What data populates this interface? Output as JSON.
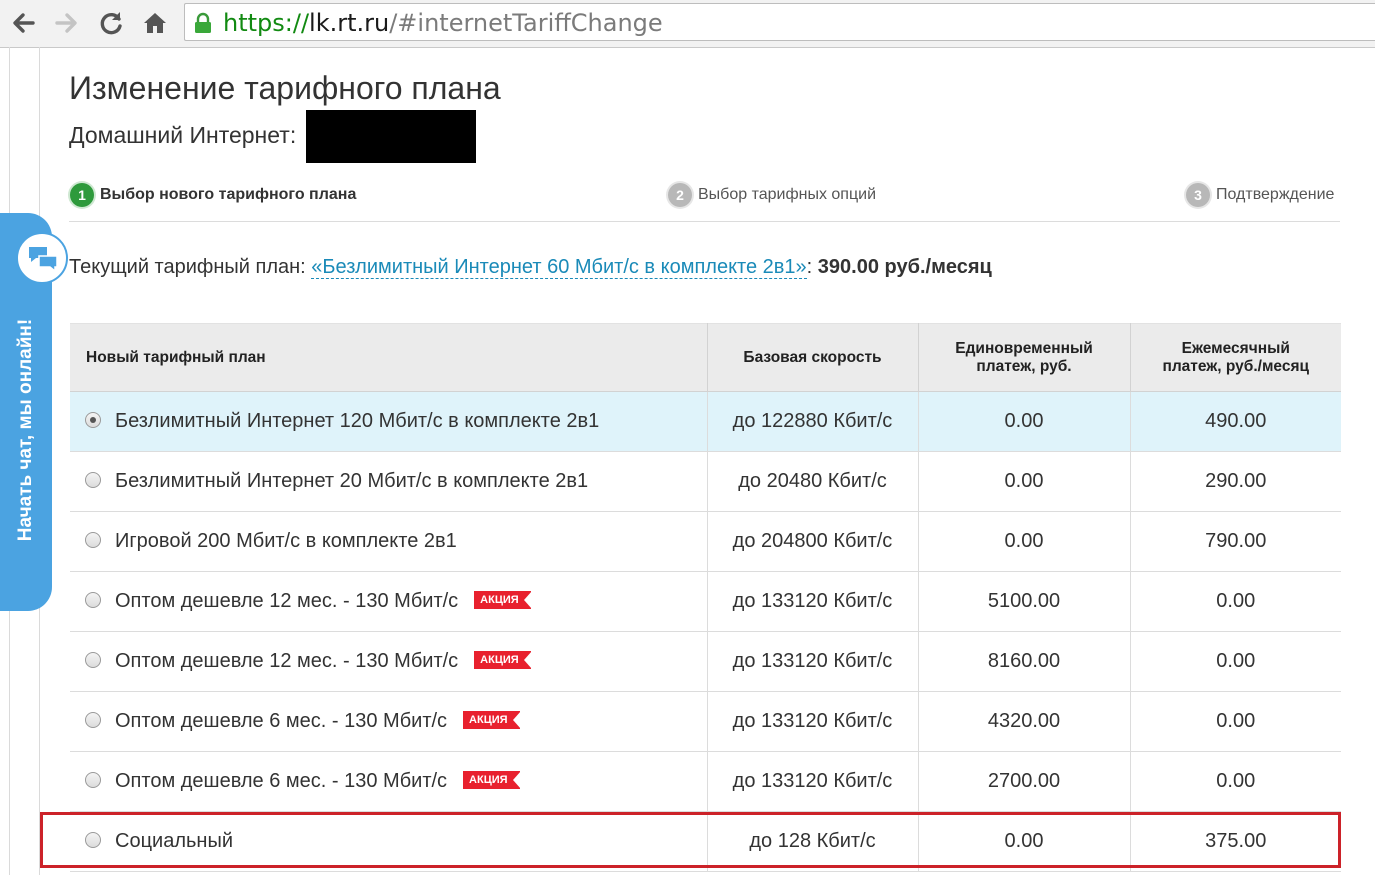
{
  "browser": {
    "url_scheme": "https://",
    "url_host": "lk.rt.ru",
    "url_path": "/#internetTariffChange"
  },
  "chat": {
    "label": "Начать чат, мы онлайн!"
  },
  "page": {
    "title": "Изменение тарифного плана",
    "service_label": "Домашний Интернет:"
  },
  "steps": [
    {
      "num": "1",
      "label": "Выбор нового тарифного плана",
      "active": true
    },
    {
      "num": "2",
      "label": "Выбор тарифных опций",
      "active": false
    },
    {
      "num": "3",
      "label": "Подтверждение",
      "active": false
    }
  ],
  "current_plan": {
    "prefix": "Текущий тарифный план: ",
    "name": "«Безлимитный Интернет 60 Мбит/с в комплекте 2в1»",
    "separator": ": ",
    "price": "390.00 руб./месяц"
  },
  "table": {
    "headers": {
      "plan": "Новый тарифный план",
      "speed": "Базовая скорость",
      "one_time_line1": "Единовременный",
      "one_time_line2": "платеж, руб.",
      "monthly_line1": "Ежемесячный",
      "monthly_line2": "платеж, руб./месяц"
    },
    "promo_label": "АКЦИЯ",
    "rows": [
      {
        "name": "Безлимитный Интернет 120 Мбит/с в комплекте 2в1",
        "speed": "до 122880 Кбит/с",
        "one_time": "0.00",
        "monthly": "490.00"
      },
      {
        "name": "Безлимитный Интернет 20 Мбит/с в комплекте 2в1",
        "speed": "до 20480 Кбит/с",
        "one_time": "0.00",
        "monthly": "290.00"
      },
      {
        "name": "Игровой 200 Мбит/с в комплекте 2в1",
        "speed": "до 204800 Кбит/с",
        "one_time": "0.00",
        "monthly": "790.00"
      },
      {
        "name": "Оптом дешевле 12 мес. - 130 Мбит/с",
        "speed": "до 133120 Кбит/с",
        "one_time": "5100.00",
        "monthly": "0.00"
      },
      {
        "name": "Оптом дешевле 12 мес. - 130 Мбит/с",
        "speed": "до 133120 Кбит/с",
        "one_time": "8160.00",
        "monthly": "0.00"
      },
      {
        "name": "Оптом дешевле 6 мес. - 130 Мбит/с",
        "speed": "до 133120 Кбит/с",
        "one_time": "4320.00",
        "monthly": "0.00"
      },
      {
        "name": "Оптом дешевле 6 мес. - 130 Мбит/с",
        "speed": "до 133120 Кбит/с",
        "one_time": "2700.00",
        "monthly": "0.00"
      },
      {
        "name": "Социальный",
        "speed": "до 128 Кбит/с",
        "one_time": "0.00",
        "monthly": "375.00"
      }
    ]
  },
  "colors": {
    "accent_green": "#2e9a3c",
    "link_blue": "#1a8ab8",
    "chat_blue": "#4ba3e1",
    "promo_red": "#e8212e",
    "highlight_red": "#cc2229",
    "selected_row": "#dff3fa"
  },
  "icons": [
    "back-arrow-icon",
    "forward-arrow-icon",
    "reload-icon",
    "home-icon",
    "lock-icon",
    "chat-bubble-icon"
  ]
}
